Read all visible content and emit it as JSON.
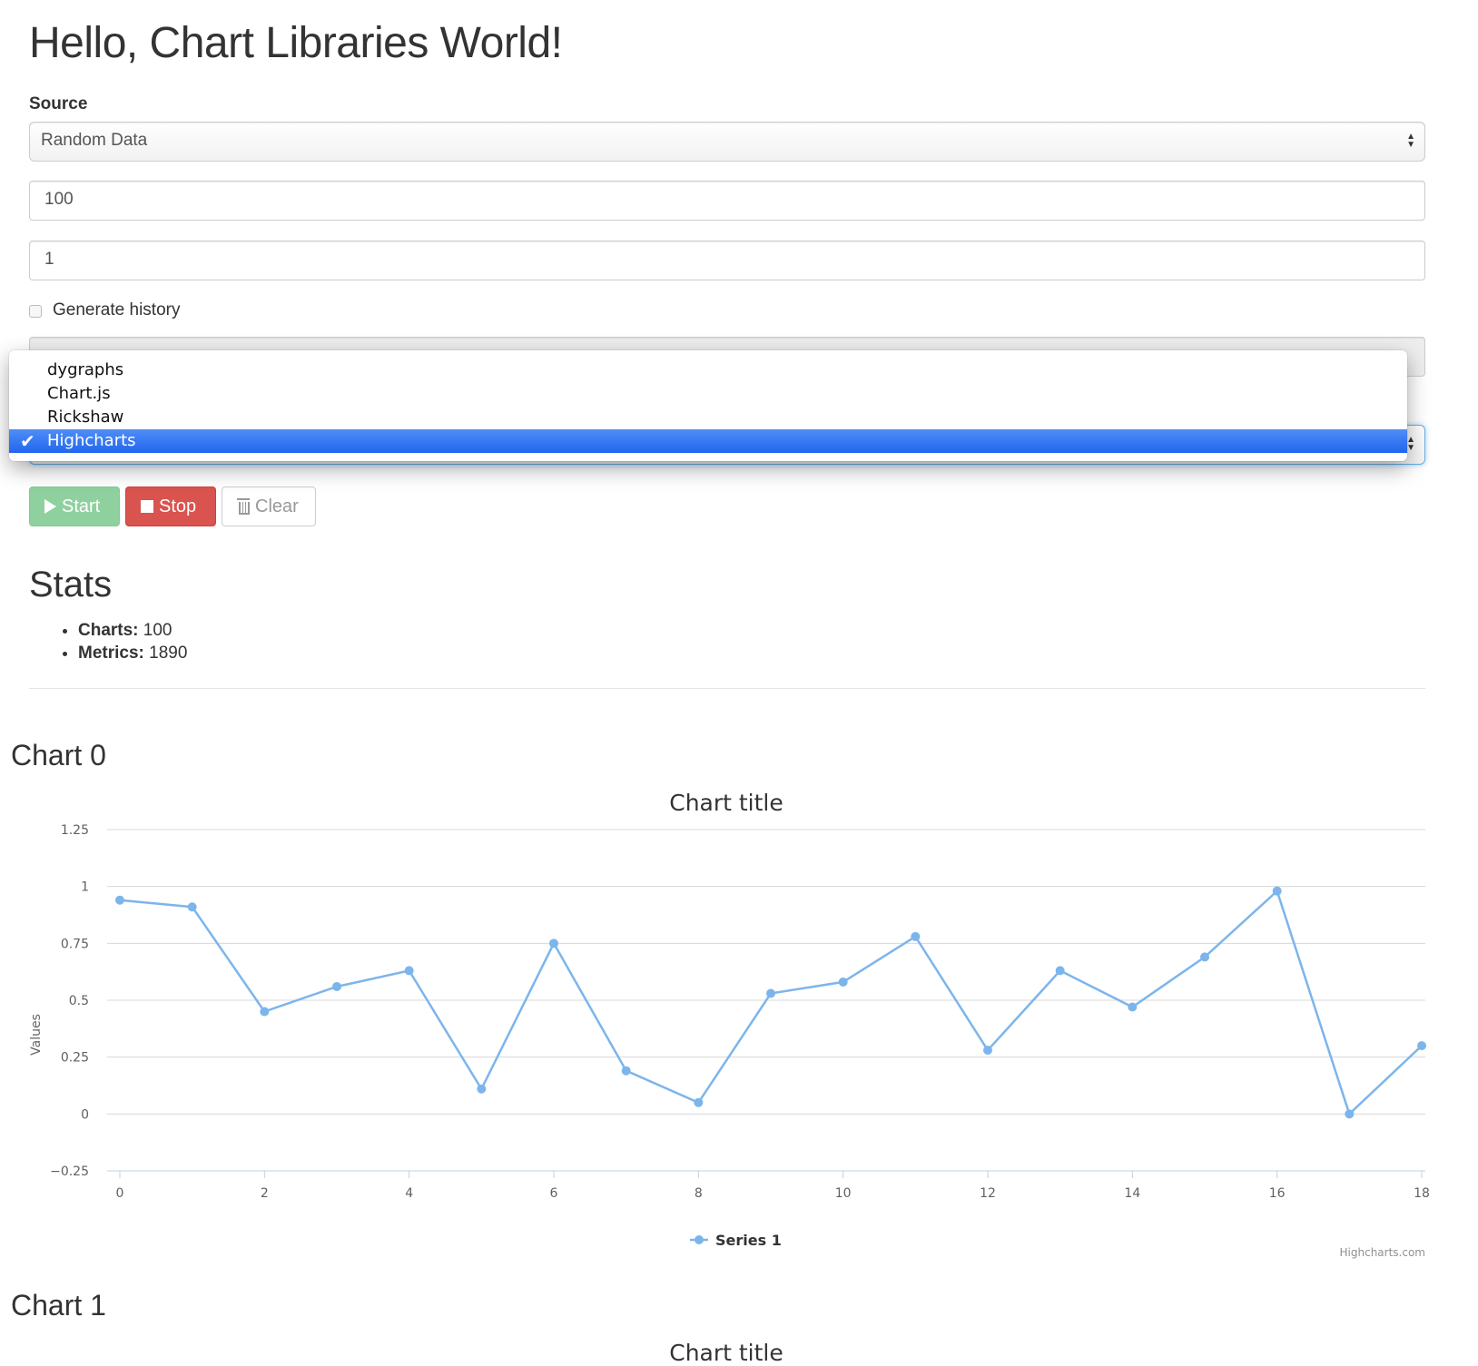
{
  "heading": "Hello, Chart Libraries World!",
  "source": {
    "label": "Source",
    "selected": "Random Data",
    "charts_value": "100",
    "interval_value": "1",
    "history_label": "Generate history"
  },
  "library": {
    "options": [
      "dygraphs",
      "Chart.js",
      "Rickshaw",
      "Highcharts"
    ],
    "selected": "Highcharts"
  },
  "buttons": {
    "start": "Start",
    "stop": "Stop",
    "clear": "Clear"
  },
  "stats": {
    "title": "Stats",
    "charts_label": "Charts:",
    "charts_value": " 100",
    "metrics_label": "Metrics:",
    "metrics_value": " 1890"
  },
  "charts": [
    {
      "heading": "Chart 0",
      "title": "Chart title"
    },
    {
      "heading": "Chart 1",
      "title": "Chart title"
    }
  ],
  "credit": "Highcharts.com",
  "colors": {
    "series": "#7cb5ec",
    "start": "#8fd19e",
    "stop": "#d9534f",
    "selected": "#2f77f0"
  },
  "chart_data": {
    "type": "line",
    "title": "Chart title",
    "ylabel": "Values",
    "xlabel": "",
    "ylim": [
      -0.25,
      1.25
    ],
    "xlim": [
      0,
      18
    ],
    "yticks": [
      "1.25",
      "1",
      "0.75",
      "0.5",
      "0.25",
      "0",
      "−0.25"
    ],
    "xticks": [
      "0",
      "2",
      "4",
      "6",
      "8",
      "10",
      "12",
      "14",
      "16",
      "18"
    ],
    "legend": "bottom-center",
    "grid": true,
    "series": [
      {
        "name": "Series 1",
        "x": [
          0,
          1,
          2,
          3,
          4,
          5,
          6,
          7,
          8,
          9,
          10,
          11,
          12,
          13,
          14,
          15,
          16,
          17,
          18
        ],
        "values": [
          0.94,
          0.91,
          0.45,
          0.56,
          0.63,
          0.11,
          0.75,
          0.19,
          0.05,
          0.53,
          0.58,
          0.78,
          0.28,
          0.63,
          0.47,
          0.69,
          0.98,
          0.0,
          0.3
        ]
      }
    ]
  }
}
